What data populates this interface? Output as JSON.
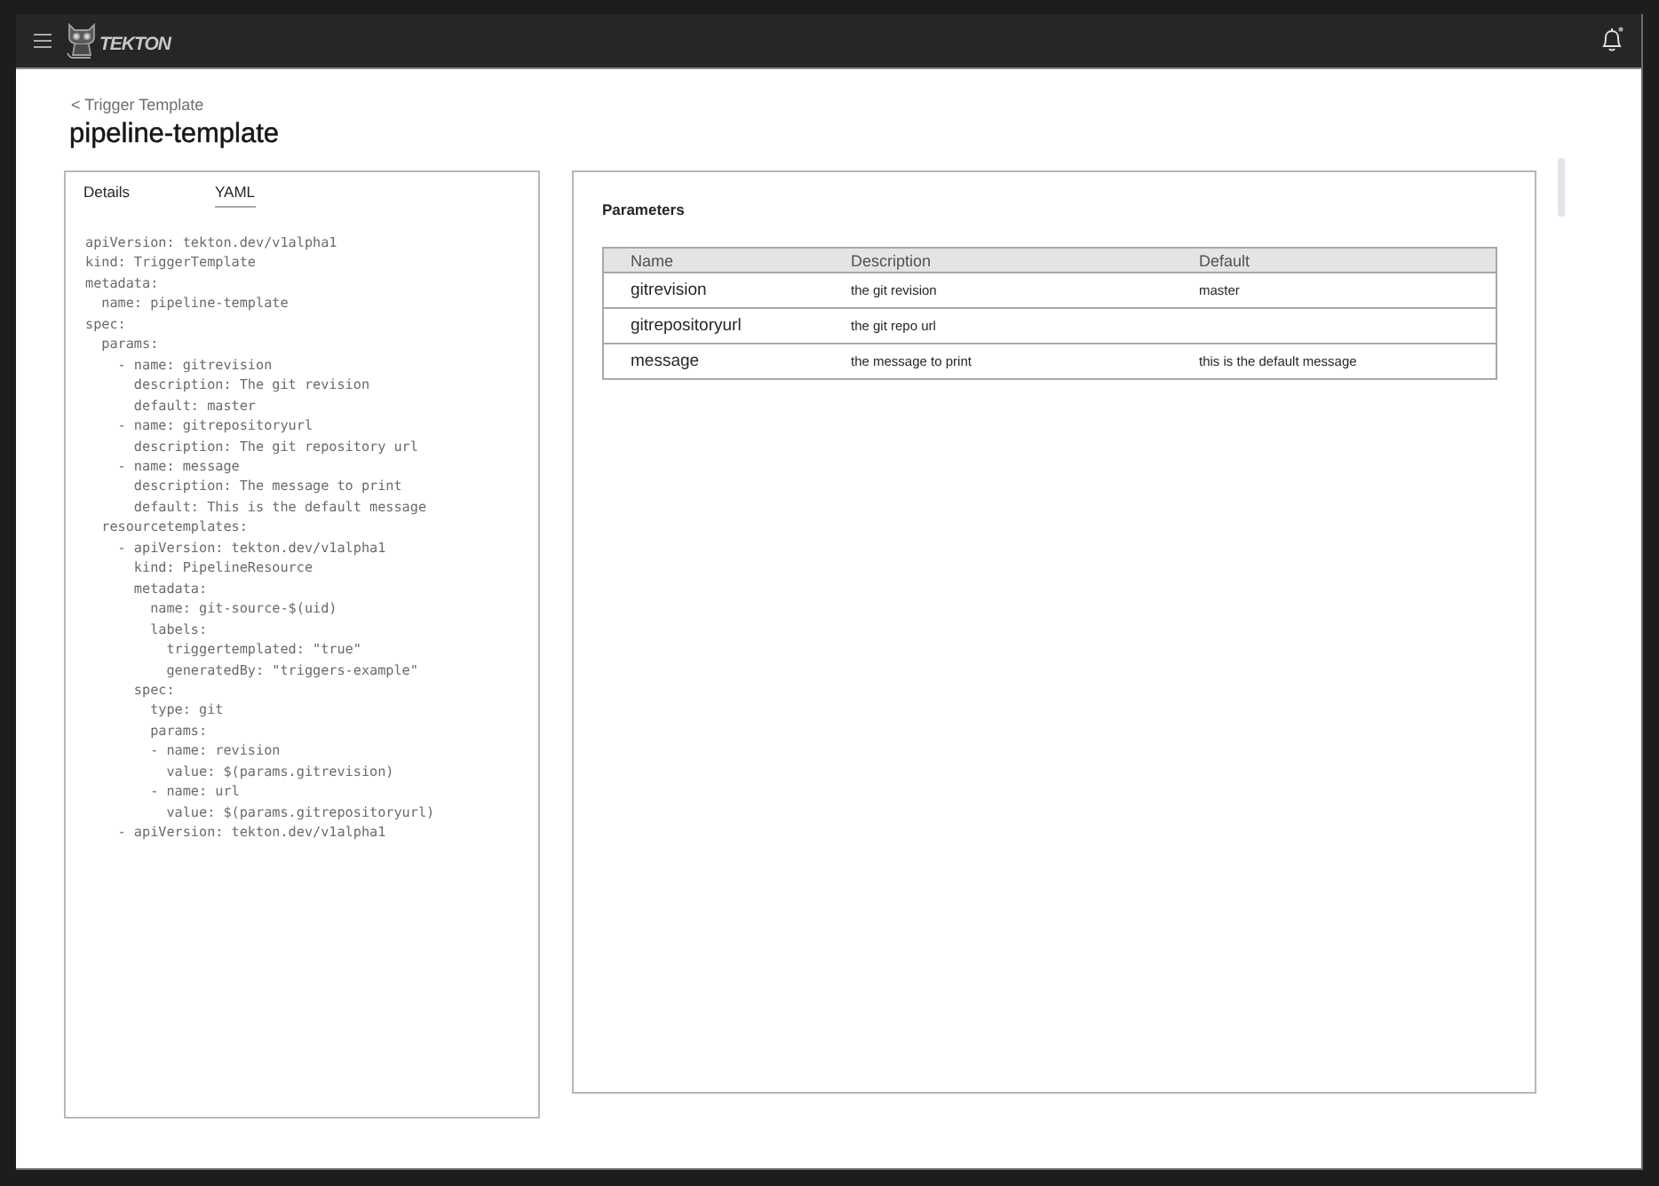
{
  "header": {
    "brand": "TEKTON"
  },
  "breadcrumb": "< Trigger Template",
  "title": "pipeline-template",
  "tabs": [
    {
      "label": "Details",
      "selected": false
    },
    {
      "label": "YAML",
      "selected": true
    }
  ],
  "yaml": "apiVersion: tekton.dev/v1alpha1\nkind: TriggerTemplate\nmetadata:\n  name: pipeline-template\nspec:\n  params:\n    - name: gitrevision\n      description: The git revision\n      default: master\n    - name: gitrepositoryurl\n      description: The git repository url\n    - name: message\n      description: The message to print\n      default: This is the default message\n  resourcetemplates:\n    - apiVersion: tekton.dev/v1alpha1\n      kind: PipelineResource\n      metadata:\n        name: git-source-$(uid)\n        labels:\n          triggertemplated: \"true\"\n          generatedBy: \"triggers-example\"\n      spec:\n        type: git\n        params:\n        - name: revision\n          value: $(params.gitrevision)\n        - name: url\n          value: $(params.gitrepositoryurl)\n    - apiVersion: tekton.dev/v1alpha1",
  "parameters": {
    "title": "Parameters",
    "columns": [
      "Name",
      "Description",
      "Default"
    ],
    "rows": [
      {
        "name": "gitrevision",
        "description": "the git revision",
        "default": "master"
      },
      {
        "name": "gitrepositoryurl",
        "description": "the git repo url"
      },
      {
        "name": "message",
        "description": "the message to print",
        "default": "this is the default message"
      }
    ]
  }
}
